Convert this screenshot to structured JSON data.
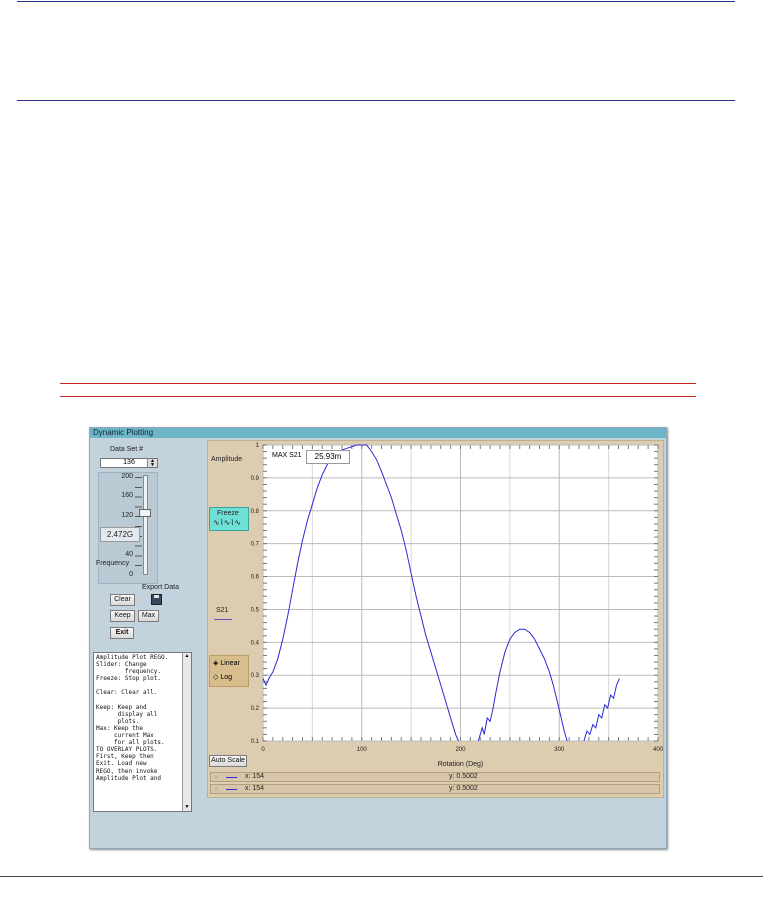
{
  "window": {
    "title": "Dynamic Plotting"
  },
  "controls": {
    "dataset_label": "Data Set #",
    "dataset_value": "136",
    "frequency_label": "Frequency",
    "frequency_value": "2.472G",
    "slider_ticks": [
      "200",
      "160",
      "120",
      "80",
      "40",
      "0"
    ],
    "slider_value": 125,
    "export_label": "Export Data",
    "clear_label": "Clear",
    "keep_label": "Keep",
    "max_label": "Max",
    "exit_label": "Exit"
  },
  "help_text": "Amplitude Plot REGO.\nSlider: Change\n        frequency.\nFreeze: Stop plot.\n\nClear: Clear all.\n\nKeep: Keep and\n      display all\n      plots.\nMax: Keep the\n     current Max\n     for all plots.\nTO OVERLAY PLOTS.\nFirst, Keep then\nExit. Load new\nREGO, then invoke\nAmplitude Plot and",
  "plot": {
    "y_title": "Amplitude",
    "x_title": "Rotation (Deg)",
    "max_label": "MAX S21",
    "max_value": "25.93m",
    "freeze_label": "Freeze",
    "series_label": "S21",
    "linear_label": "Linear",
    "log_label": "Log",
    "scale_mode": "Linear",
    "autoscale_label": "Auto Scale",
    "series_color": "#2a2ad8",
    "legend": [
      {
        "x": "x: 154",
        "y": "y: 0.5002"
      },
      {
        "x": "x: 154",
        "y": "y: 0.5002"
      }
    ]
  },
  "chart_data": {
    "type": "line",
    "xlabel": "Rotation (Deg)",
    "ylabel": "Amplitude",
    "xlim": [
      0,
      400
    ],
    "ylim": [
      0.1,
      1
    ],
    "x_ticks": [
      "0",
      "100",
      "200",
      "300",
      "400"
    ],
    "y_ticks": [
      "1",
      "0.9",
      "0.8",
      "0.7",
      "0.6",
      "0.5",
      "0.4",
      "0.3",
      "0.2",
      "0.1"
    ],
    "grid": true,
    "series": [
      {
        "name": "S21",
        "points": [
          [
            0,
            0.29
          ],
          [
            3,
            0.27
          ],
          [
            6,
            0.29
          ],
          [
            10,
            0.31
          ],
          [
            15,
            0.35
          ],
          [
            20,
            0.41
          ],
          [
            25,
            0.48
          ],
          [
            30,
            0.56
          ],
          [
            35,
            0.64
          ],
          [
            40,
            0.71
          ],
          [
            45,
            0.77
          ],
          [
            50,
            0.82
          ],
          [
            55,
            0.87
          ],
          [
            60,
            0.91
          ],
          [
            65,
            0.94
          ],
          [
            70,
            0.96
          ],
          [
            75,
            0.975
          ],
          [
            80,
            0.985
          ],
          [
            85,
            0.99
          ],
          [
            90,
            0.995
          ],
          [
            95,
            1.0
          ],
          [
            100,
            1.0
          ],
          [
            105,
            1.0
          ],
          [
            110,
            0.98
          ],
          [
            115,
            0.955
          ],
          [
            120,
            0.92
          ],
          [
            125,
            0.88
          ],
          [
            130,
            0.84
          ],
          [
            135,
            0.79
          ],
          [
            140,
            0.74
          ],
          [
            145,
            0.68
          ],
          [
            150,
            0.61
          ],
          [
            155,
            0.54
          ],
          [
            160,
            0.48
          ],
          [
            165,
            0.42
          ],
          [
            170,
            0.37
          ],
          [
            175,
            0.32
          ],
          [
            180,
            0.27
          ],
          [
            185,
            0.22
          ],
          [
            190,
            0.17
          ],
          [
            195,
            0.12
          ],
          [
            198,
            0.1
          ],
          null,
          [
            218,
            0.1
          ],
          [
            222,
            0.14
          ],
          [
            224,
            0.12
          ],
          [
            227,
            0.17
          ],
          [
            230,
            0.16
          ],
          [
            233,
            0.2
          ],
          [
            236,
            0.25
          ],
          [
            240,
            0.31
          ],
          [
            245,
            0.37
          ],
          [
            250,
            0.41
          ],
          [
            255,
            0.43
          ],
          [
            260,
            0.44
          ],
          [
            265,
            0.44
          ],
          [
            270,
            0.43
          ],
          [
            275,
            0.41
          ],
          [
            280,
            0.38
          ],
          [
            285,
            0.35
          ],
          [
            290,
            0.31
          ],
          [
            294,
            0.27
          ],
          [
            298,
            0.22
          ],
          [
            302,
            0.17
          ],
          [
            305,
            0.13
          ],
          [
            308,
            0.1
          ],
          null,
          [
            325,
            0.1
          ],
          [
            328,
            0.13
          ],
          [
            331,
            0.12
          ],
          [
            334,
            0.15
          ],
          [
            337,
            0.14
          ],
          [
            340,
            0.18
          ],
          [
            343,
            0.17
          ],
          [
            346,
            0.21
          ],
          [
            349,
            0.2
          ],
          [
            352,
            0.24
          ],
          [
            355,
            0.23
          ],
          [
            358,
            0.27
          ],
          [
            361,
            0.29
          ]
        ]
      }
    ]
  }
}
